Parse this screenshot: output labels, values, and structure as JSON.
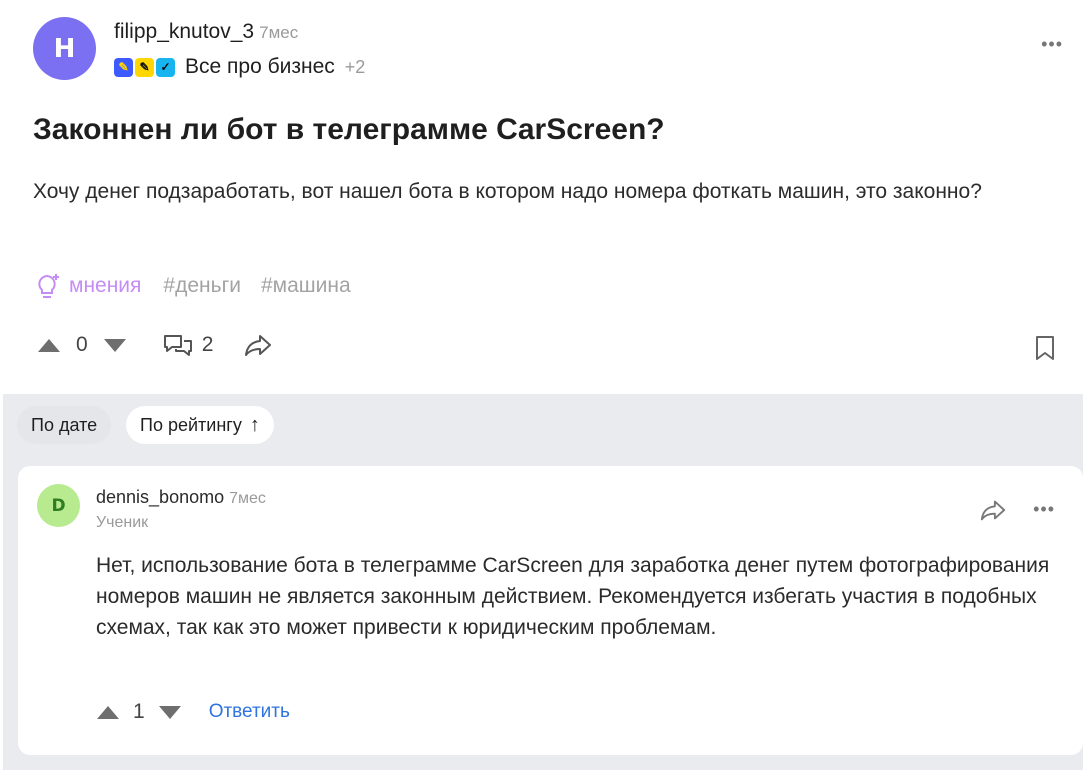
{
  "question": {
    "avatar_letter": "H",
    "author": "filipp_knutov_3",
    "time": "7мес",
    "topic": "Все про бизнес",
    "topic_extra": "+2",
    "title": "Законнен ли бот в телеграмме CarScreen?",
    "body": "Хочу денег подзаработать, вот нашел бота в котором надо номера фоткать машин, это законно?",
    "tags": {
      "opinion": "мнения",
      "items": [
        "#деньги",
        "#машина"
      ]
    },
    "votes": "0",
    "comments": "2",
    "icons": [
      "lightbulb-icon",
      "upvote-icon",
      "downvote-icon",
      "comments-icon",
      "share-icon",
      "bookmark-icon",
      "more-icon"
    ]
  },
  "sort": {
    "by_date": "По дате",
    "by_rating": "По рейтингу",
    "rating_arrow": "↑"
  },
  "comment": {
    "avatar_letter": "D",
    "author": "dennis_bonomo",
    "time": "7мес",
    "rank": "Ученик",
    "body": "Нет, использование бота в телеграмме CarScreen для заработка денег путем фотографирования номеров машин не является законным действием. Рекомендуется избегать участия в подобных схемах, так как это может привести к юридическим проблемам.",
    "votes": "1",
    "reply": "Ответить"
  },
  "colors": {
    "avatar_question": "#7b6ff2",
    "avatar_comment": "#b8ea8f",
    "opinion_tag": "#c58cf5",
    "reply_link": "#2f73e0",
    "comments_bg": "#e9ebee"
  }
}
